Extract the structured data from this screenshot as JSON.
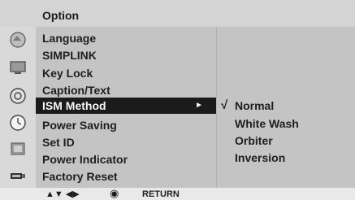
{
  "menu": {
    "title": "Option",
    "items": [
      {
        "label": "Language"
      },
      {
        "label": "SIMPLINK"
      },
      {
        "label": "Key Lock"
      },
      {
        "label": "Caption/Text"
      },
      {
        "label": "ISM Method",
        "selected": true
      },
      {
        "label": "Power Saving"
      },
      {
        "label": "Set ID"
      },
      {
        "label": "Power Indicator"
      },
      {
        "label": "Factory Reset"
      }
    ],
    "submenu_arrow": "►"
  },
  "submenu": {
    "check_mark": "√",
    "options": [
      "Normal",
      "White Wash",
      "Orbiter",
      "Inversion"
    ]
  },
  "icons": [
    "picture-icon",
    "screen-icon",
    "speaker-icon",
    "clock-icon",
    "lock-icon",
    "input-icon"
  ],
  "hints": {
    "move_arrows": "▲▼ ◀▶",
    "ok_symbol": "◉",
    "return_label": "RETURN"
  },
  "colors": {
    "selected_bg": "#1b1b1b",
    "panel_bg": "#c4c4c4",
    "title_bg": "#d4d4d4"
  }
}
